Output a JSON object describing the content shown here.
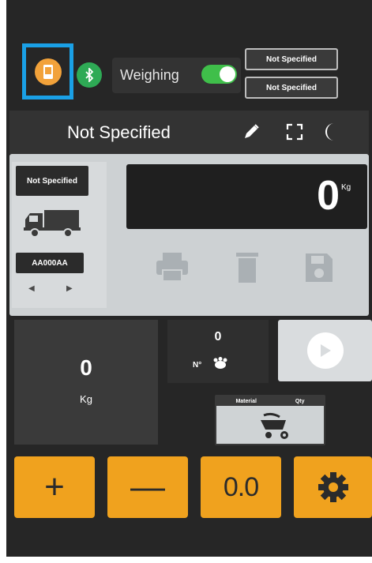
{
  "topbar": {
    "mode_icon": "receipt-icon",
    "bluetooth_icon": "bluetooth-icon",
    "weighing_label": "Weighing",
    "weighing_toggle_on": true,
    "selector_top": "Not Specified",
    "selector_bottom": "Not Specified"
  },
  "titlebar": {
    "title": "Not Specified",
    "edit_icon": "pencil-icon",
    "fullscreen_icon": "fullscreen-icon",
    "theme_icon": "moon-icon"
  },
  "scale": {
    "product_chip": "Not Specified",
    "vehicle_icon": "truck-icon",
    "plate": "AA000AA",
    "weight": "0",
    "unit": "Kg",
    "actions": [
      "print-icon",
      "delete-icon",
      "save-icon"
    ]
  },
  "summary": {
    "total_value": "0",
    "total_unit": "Kg",
    "count_value": "0",
    "count_label": "N°",
    "material_label": "Material",
    "qty_label": "Qty"
  },
  "buttons": {
    "plus": "+",
    "minus": "—",
    "zero": "0.0"
  },
  "colors": {
    "accent": "#f0a21e",
    "highlight_border": "#1aa0e6",
    "toggle_on": "#3fbf4a",
    "bluetooth": "#2eaa55"
  }
}
